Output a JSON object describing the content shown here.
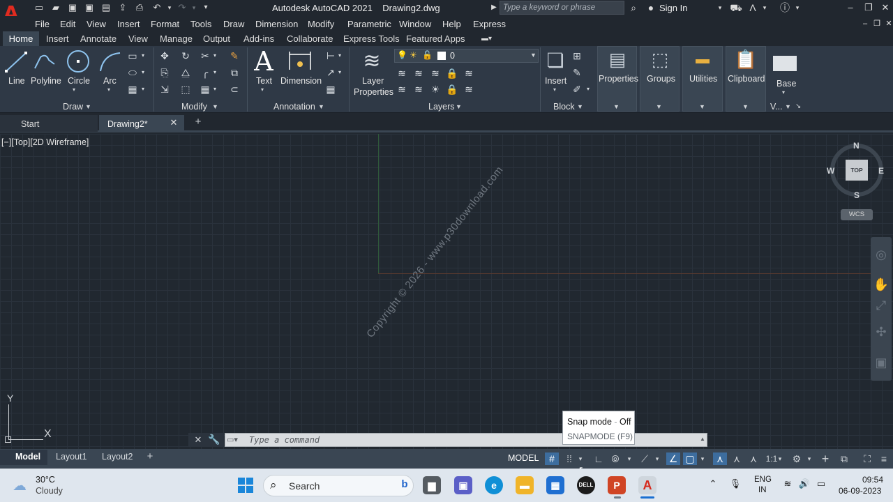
{
  "titlebar": {
    "app_logo": "A",
    "title": "Autodesk AutoCAD 2021    Drawing2.dwg",
    "search_placeholder": "Type a keyword or phrase",
    "signin": "Sign In"
  },
  "menubar": [
    "File",
    "Edit",
    "View",
    "Insert",
    "Format",
    "Tools",
    "Draw",
    "Dimension",
    "Modify",
    "Parametric",
    "Window",
    "Help",
    "Express"
  ],
  "ribbon_tabs": [
    "Home",
    "Insert",
    "Annotate",
    "View",
    "Manage",
    "Output",
    "Add-ins",
    "Collaborate",
    "Express Tools",
    "Featured Apps"
  ],
  "ribbon": {
    "draw": {
      "title": "Draw",
      "tools": [
        "Line",
        "Polyline",
        "Circle",
        "Arc"
      ]
    },
    "modify": {
      "title": "Modify"
    },
    "annotation": {
      "title": "Annotation",
      "tools": [
        "Text",
        "Dimension"
      ]
    },
    "layers": {
      "title": "Layers",
      "tool_line1": "Layer",
      "tool_line2": "Properties",
      "current_layer": "0"
    },
    "block": {
      "title": "Block",
      "tool": "Insert"
    },
    "properties": "Properties",
    "groups": "Groups",
    "utilities": "Utilities",
    "clipboard": "Clipboard",
    "base": "Base",
    "view_abbr": "V..."
  },
  "file_tabs": {
    "start": "Start",
    "drawing": "Drawing2*"
  },
  "canvas": {
    "viewport_label": "[−][Top][2D Wireframe]",
    "watermark": "Copyright © 2026 - www.p30download.com"
  },
  "viewcube": {
    "n": "N",
    "s": "S",
    "e": "E",
    "w": "W",
    "face": "TOP",
    "wcs": "WCS"
  },
  "ucs": {
    "x": "X",
    "y": "Y"
  },
  "command": {
    "placeholder": "Type a command"
  },
  "tooltip": {
    "title_prefix": "Snap mode",
    "title_sep": " - ",
    "title_state": "Off",
    "subtitle": "SNAPMODE (F9)"
  },
  "layout_tabs": {
    "model": "Model",
    "layout1": "Layout1",
    "layout2": "Layout2"
  },
  "status": {
    "model": "MODEL",
    "scale": "1:1"
  },
  "taskbar": {
    "temp": "30°C",
    "weather": "Cloudy",
    "search": "Search",
    "lang1": "ENG",
    "lang2": "IN",
    "time": "09:54",
    "date": "06-09-2023"
  }
}
